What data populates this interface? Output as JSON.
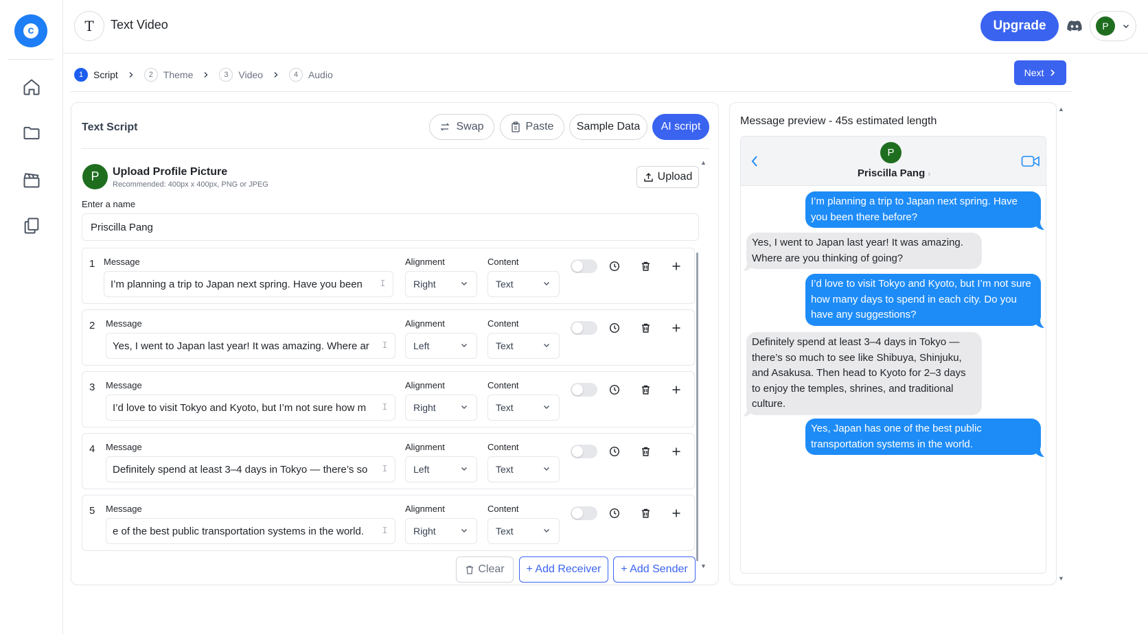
{
  "header": {
    "app_title": "Text Video",
    "upgrade_label": "Upgrade",
    "avatar_initial": "P"
  },
  "steps": [
    {
      "num": "1",
      "label": "Script"
    },
    {
      "num": "2",
      "label": "Theme"
    },
    {
      "num": "3",
      "label": "Video"
    },
    {
      "num": "4",
      "label": "Audio"
    }
  ],
  "next_label": "Next",
  "script_panel": {
    "title": "Text Script",
    "swap_label": "Swap",
    "paste_label": "Paste",
    "sample_label": "Sample Data",
    "ai_label": "AI script",
    "profile_initial": "P",
    "profile_title": "Upload Profile Picture",
    "profile_sub": "Recommended: 400px x 400px, PNG or JPEG",
    "upload_label": "Upload",
    "name_label": "Enter a name",
    "name_value": "Priscilla Pang",
    "message_label": "Message",
    "alignment_label": "Alignment",
    "content_label": "Content",
    "messages": [
      {
        "num": "1",
        "text": "I’m planning a trip to Japan next spring. Have you been",
        "alignment": "Right",
        "content": "Text"
      },
      {
        "num": "2",
        "text": "Yes, I went to Japan last year! It was amazing. Where ar",
        "alignment": "Left",
        "content": "Text"
      },
      {
        "num": "3",
        "text": "I’d love to visit Tokyo and Kyoto, but I’m not sure how m",
        "alignment": "Right",
        "content": "Text"
      },
      {
        "num": "4",
        "text": "Definitely spend at least 3–4 days in Tokyo — there’s so",
        "alignment": "Left",
        "content": "Text"
      },
      {
        "num": "5",
        "text": "e of the best public transportation systems in the world.",
        "alignment": "Right",
        "content": "Text"
      }
    ],
    "clear_label": "Clear",
    "add_receiver_label": "+ Add Receiver",
    "add_sender_label": "+ Add Sender"
  },
  "preview": {
    "title": "Message preview - 45s estimated length",
    "contact_initial": "P",
    "contact_name": "Priscilla Pang",
    "contact_chevron": "›",
    "bubbles": [
      {
        "side": "right",
        "text": "I’m planning a trip to Japan next spring. Have you been there before?"
      },
      {
        "side": "left",
        "text": "Yes, I went to Japan last year! It was amazing. Where are you thinking of going?"
      },
      {
        "side": "right",
        "text": "I’d love to visit Tokyo and Kyoto, but I’m not sure how many days to spend in each city. Do you have any suggestions?"
      },
      {
        "side": "left",
        "text": "Definitely spend at least 3–4 days in Tokyo — there’s so much to see like Shibuya, Shinjuku, and Asakusa. Then head to Kyoto for 2–3 days to enjoy the temples, shrines, and traditional culture."
      },
      {
        "side": "right",
        "text": "Yes, Japan has one of the best public transportation systems in the world."
      }
    ]
  },
  "colors": {
    "accent": "#3a63f0",
    "bubble_blue": "#1e8cf7",
    "bubble_gray": "#e9e9eb",
    "avatar_green": "#1f6e1f"
  }
}
